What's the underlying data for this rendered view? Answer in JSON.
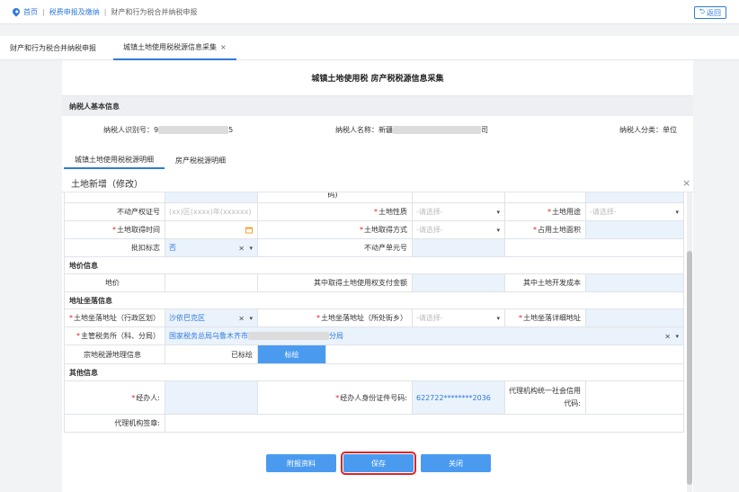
{
  "breadcrumb": {
    "home": "首页",
    "level1": "税费申报及缴纳",
    "current": "财产和行为税合并纳税申报",
    "back": "返回"
  },
  "tabs": [
    {
      "label": "财产和行为税合并纳税申报"
    },
    {
      "label": "城镇土地使用税税源信息采集",
      "close": "×"
    }
  ],
  "panel": {
    "title": "城镇土地使用税 房产税税源信息采集",
    "section": "纳税人基本信息",
    "taxpayer_id_label": "纳税人识别号：",
    "taxpayer_id_start": "9",
    "taxpayer_id_end": "5",
    "taxpayer_name_label": "纳税人名称：",
    "taxpayer_name_start": "新疆",
    "taxpayer_name_end": "司",
    "taxpayer_type": "纳税人分类：单位",
    "subtabs": [
      "城镇土地使用税税源明细",
      "房产税税源明细"
    ]
  },
  "dialog": {
    "title": "土地新增（修改）",
    "close": "×"
  },
  "form": {
    "row0": {
      "label_a": "",
      "label_b": "码)",
      "label_c": ""
    },
    "row1": {
      "label_a": "不动产权证号",
      "placeholder_a": "(xx)区(xxxx)年(xxxxxx)",
      "label_b": "土地性质",
      "placeholder_b": "-请选择-",
      "label_c": "土地用途",
      "placeholder_c": "-请选择-"
    },
    "row2": {
      "label_a": "土地取得时间",
      "label_b": "土地取得方式",
      "placeholder_b": "-请选择-",
      "label_c": "占用土地面积"
    },
    "row3": {
      "label_a": "批扣标志",
      "value_a": "否",
      "label_b": "不动产单元号"
    },
    "group_price": "地价信息",
    "row4": {
      "label_a": "地价",
      "label_b": "其中取得土地使用权支付金额",
      "label_c": "其中土地开发成本"
    },
    "group_address": "地址坐落信息",
    "row5": {
      "label_a": "土地坐落地址（行政区划）",
      "value_a": "沙依巴克区",
      "label_b": "土地坐落地址（所处街乡）",
      "placeholder_b": "-请选择-",
      "label_c": "土地坐落详细地址"
    },
    "row6": {
      "label_a": "主管税务所（科、分局）",
      "value_start": "国家税务总局乌鲁木齐市",
      "value_end": "分局"
    },
    "row7": {
      "label_a": "宗地税源地理信息",
      "status": "已标绘",
      "button": "标绘"
    },
    "group_other": "其他信息",
    "row8": {
      "label_a": "经办人:",
      "label_b": "经办人身份证件号码:",
      "value_b": "622722********2036",
      "label_c_1": "代理机构统一社会信用",
      "label_c_2": "代码:"
    },
    "row9": {
      "label_a": "代理机构签章:"
    }
  },
  "buttons": {
    "attach": "附报资料",
    "save": "保存",
    "close": "关闭"
  },
  "icons": {
    "clear": "×",
    "dropdown": "▾"
  }
}
